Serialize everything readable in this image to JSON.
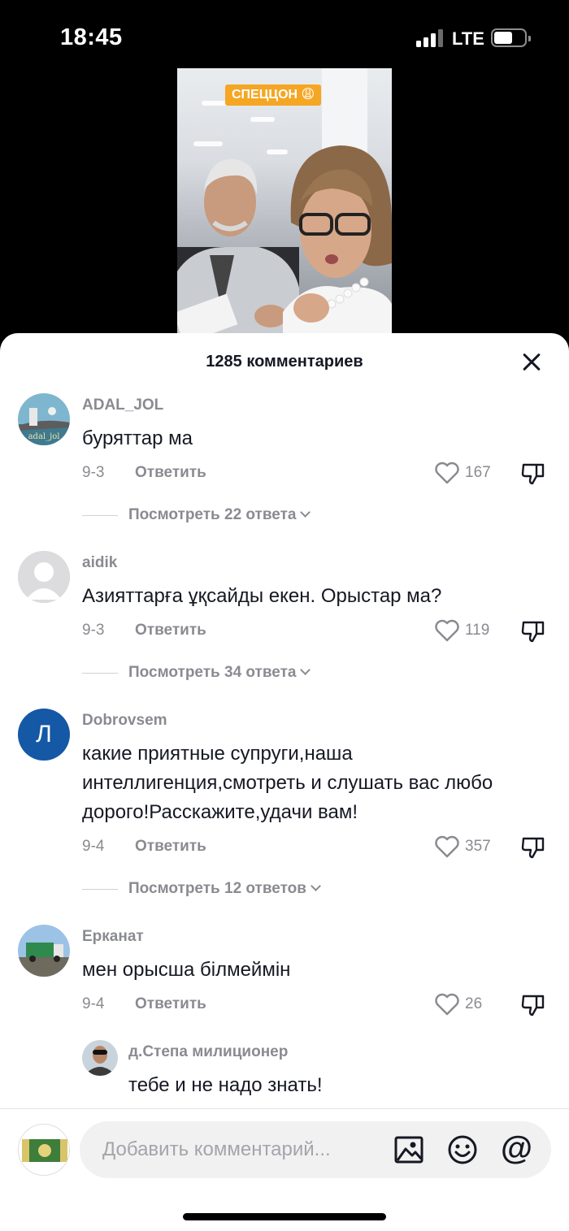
{
  "status_bar": {
    "time": "18:45",
    "network": "LTE",
    "battery_level": 0.6
  },
  "video": {
    "tag_text": "СПЕЦЦОН 😩"
  },
  "comments_header": {
    "title": "1285 комментариев",
    "close_icon": "close-icon"
  },
  "comments": [
    {
      "username": "ADAL_JOL",
      "avatar_text": "adal_jol",
      "text": "буряттар ма",
      "date": "9-3",
      "reply_label": "Ответить",
      "likes": "167",
      "replies_link": "Посмотреть 22 ответа"
    },
    {
      "username": "aidik",
      "text": "Азияттарға ұқсайды екен. Орыстар ма?",
      "date": "9-3",
      "reply_label": "Ответить",
      "likes": "119",
      "replies_link": "Посмотреть 34 ответа"
    },
    {
      "username": "Dobrovsem",
      "avatar_letter": "Л",
      "text": "какие приятные супруги,наша интеллигенция,смотреть и слушать вас любо дорого!Расскажите,удачи вам!",
      "date": "9-4",
      "reply_label": "Ответить",
      "likes": "357",
      "replies_link": "Посмотреть 12 ответов"
    },
    {
      "username": "Ерканат",
      "text": "мен орысша білмеймін",
      "date": "9-4",
      "reply_label": "Ответить",
      "likes": "26"
    }
  ],
  "reply": {
    "username": "д.Степа милиционер",
    "text": "тебе и не надо знать!"
  },
  "composer": {
    "placeholder": "Добавить комментарий...",
    "icons": [
      "image-icon",
      "emoji-icon",
      "mention-icon"
    ],
    "mention_glyph": "@"
  },
  "colors": {
    "accent_blue": "#1558a5",
    "muted_text": "#8a8b91",
    "tag_orange": "#f5a623"
  }
}
